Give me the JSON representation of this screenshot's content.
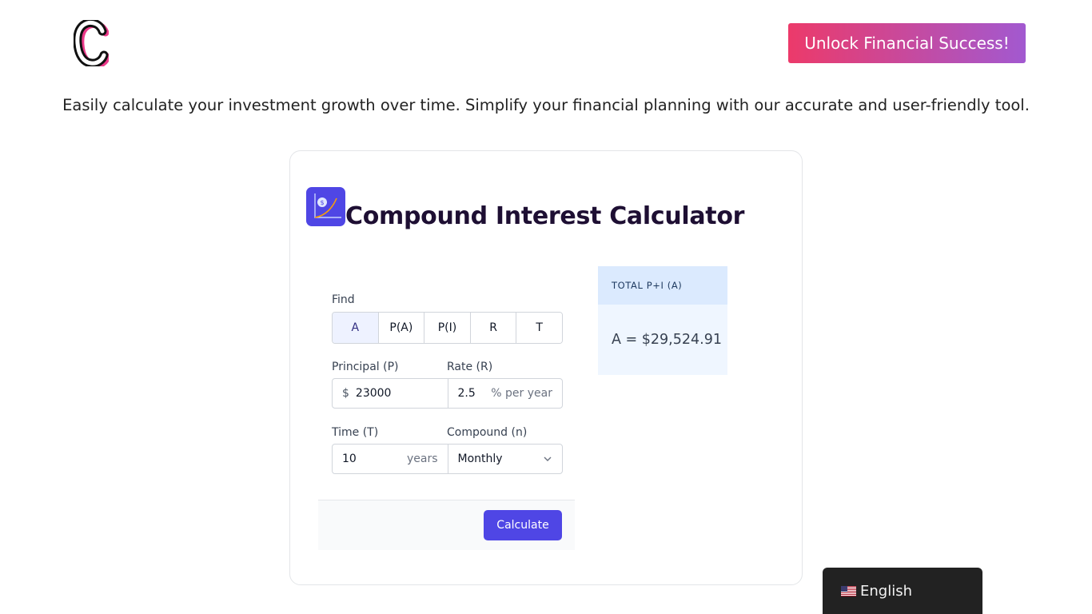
{
  "header": {
    "logo_icon": "c-logo-icon",
    "cta_label": "Unlock Financial Success!"
  },
  "tagline": "Easily calculate your investment growth over time. Simplify your financial planning with our accurate and user-friendly tool.",
  "calculator": {
    "icon": "interest-chart-icon",
    "title": "Compound Interest Calculator",
    "find_label": "Find",
    "find_options": [
      "A",
      "P(A)",
      "P(I)",
      "R",
      "T"
    ],
    "find_selected": "A",
    "principal": {
      "label": "Principal (P)",
      "prefix": "$",
      "value": "23000"
    },
    "rate": {
      "label": "Rate (R)",
      "value": "2.5",
      "suffix": "% per year"
    },
    "time": {
      "label": "Time (T)",
      "value": "10",
      "suffix": "years"
    },
    "compound": {
      "label": "Compound (n)",
      "selected": "Monthly"
    },
    "calculate_label": "Calculate",
    "result": {
      "header": "TOTAL P+I (A)",
      "value": "A = $29,524.91"
    }
  },
  "language": {
    "label": "English",
    "flag_icon": "us-flag-icon"
  },
  "colors": {
    "accent": "#4f46e5",
    "cta_gradient_start": "#ec3a6a",
    "cta_gradient_end": "#a259d0",
    "result_header_bg": "#dbeafe",
    "result_bg": "#eff6ff"
  }
}
